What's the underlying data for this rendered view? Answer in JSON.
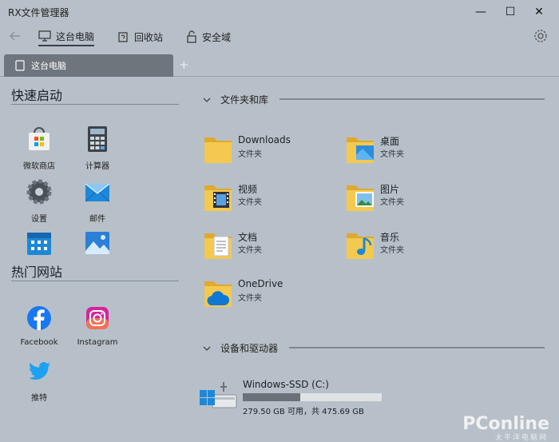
{
  "window": {
    "title": "RX文件管理器",
    "minimize": "—",
    "maximize": "☐",
    "close": "✕"
  },
  "nav": {
    "back_icon": "back-arrow-icon",
    "items": [
      {
        "label": "这台电脑",
        "icon": "this-pc-icon",
        "active": true
      },
      {
        "label": "回收站",
        "icon": "recycle-bin-icon",
        "active": false
      },
      {
        "label": "安全域",
        "icon": "secure-area-icon",
        "active": false
      }
    ],
    "settings_icon": "gear-icon"
  },
  "tabs": {
    "items": [
      {
        "label": "这台电脑"
      }
    ],
    "add_label": "+"
  },
  "sidebar": {
    "quick_launch_title": "快速启动",
    "quick_launch": [
      {
        "label": "微软商店",
        "icon": "microsoft-store-icon"
      },
      {
        "label": "计算器",
        "icon": "calculator-icon"
      },
      {
        "label": "设置",
        "icon": "settings-gear-icon"
      },
      {
        "label": "邮件",
        "icon": "mail-icon"
      },
      {
        "label": "",
        "icon": "calendar-icon"
      },
      {
        "label": "",
        "icon": "photos-icon"
      }
    ],
    "hot_sites_title": "热门网站",
    "hot_sites": [
      {
        "label": "Facebook",
        "icon": "facebook-icon"
      },
      {
        "label": "Instagram",
        "icon": "instagram-icon"
      },
      {
        "label": "推特",
        "icon": "twitter-icon"
      }
    ]
  },
  "content": {
    "folders_header": "文件夹和库",
    "folders": [
      {
        "name": "Downloads",
        "type": "文件夹",
        "icon": "downloads-folder-icon"
      },
      {
        "name": "桌面",
        "type": "文件夹",
        "icon": "desktop-folder-icon"
      },
      {
        "name": "视频",
        "type": "文件夹",
        "icon": "videos-folder-icon"
      },
      {
        "name": "图片",
        "type": "文件夹",
        "icon": "pictures-folder-icon"
      },
      {
        "name": "文档",
        "type": "文件夹",
        "icon": "documents-folder-icon"
      },
      {
        "name": "音乐",
        "type": "文件夹",
        "icon": "music-folder-icon"
      },
      {
        "name": "OneDrive",
        "type": "文件夹",
        "icon": "onedrive-folder-icon"
      }
    ],
    "drives_header": "设备和驱动器",
    "drives": [
      {
        "name": "Windows-SSD (C:)",
        "size_text": "279.50 GB 可用，共 475.69 GB",
        "used_fraction": 0.412,
        "icon": "windows-drive-icon"
      }
    ]
  },
  "watermark": {
    "text": "PConline",
    "sub": "太平洋电脑网"
  },
  "colors": {
    "background": "#b7c0c8",
    "tab_active": "#6e757c",
    "folder_yellow": "#f3c94f",
    "accent_blue": "#1e88d8"
  }
}
